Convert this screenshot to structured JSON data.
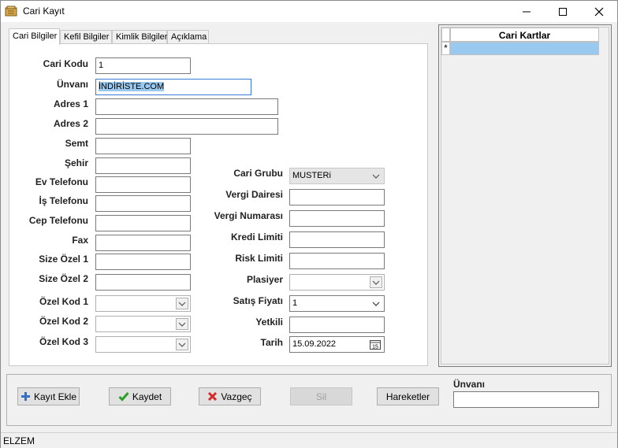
{
  "window": {
    "title": "Cari Kayıt",
    "minimize": "—",
    "maximize": "☐",
    "close": "✕"
  },
  "tabs": [
    "Cari Bilgiler",
    "Kefil Bilgiler",
    "Kimlik Bilgiler",
    "Açıklama"
  ],
  "left_fields": {
    "cari_kodu": {
      "label": "Cari Kodu",
      "value": "1"
    },
    "unvani": {
      "label": "Ünvanı",
      "value": "İNDİRİSTE.COM"
    },
    "adres1": {
      "label": "Adres 1",
      "value": ""
    },
    "adres2": {
      "label": "Adres 2",
      "value": ""
    },
    "semt": {
      "label": "Semt",
      "value": ""
    },
    "sehir": {
      "label": "Şehir",
      "value": ""
    },
    "ev_telefonu": {
      "label": "Ev Telefonu",
      "value": ""
    },
    "is_telefonu": {
      "label": "İş Telefonu",
      "value": ""
    },
    "cep_telefonu": {
      "label": "Cep Telefonu",
      "value": ""
    },
    "fax": {
      "label": "Fax",
      "value": ""
    },
    "size_ozel1": {
      "label": "Size Özel 1",
      "value": ""
    },
    "size_ozel2": {
      "label": "Size Özel 2",
      "value": ""
    },
    "ozel_kod1": {
      "label": "Özel Kod 1",
      "value": ""
    },
    "ozel_kod2": {
      "label": "Özel Kod 2",
      "value": ""
    },
    "ozel_kod3": {
      "label": "Özel Kod 3",
      "value": ""
    }
  },
  "right_fields": {
    "cari_grubu": {
      "label": "Cari Grubu",
      "value": "MUSTERi"
    },
    "vergi_dairesi": {
      "label": "Vergi Dairesi",
      "value": ""
    },
    "vergi_numarasi": {
      "label": "Vergi Numarası",
      "value": ""
    },
    "kredi_limiti": {
      "label": "Kredi Limiti",
      "value": ""
    },
    "risk_limiti": {
      "label": "Risk Limiti",
      "value": ""
    },
    "plasiyer": {
      "label": "Plasiyer",
      "value": ""
    },
    "satis_fiyati": {
      "label": "Satış Fiyatı",
      "value": "1"
    },
    "yetkili": {
      "label": "Yetkili",
      "value": ""
    },
    "tarih": {
      "label": "Tarih",
      "value": "15.09.2022"
    }
  },
  "grid": {
    "header": "Cari Kartlar",
    "new_row_marker": "*"
  },
  "buttons": {
    "kayit_ekle": "Kayıt Ekle",
    "kaydet": "Kaydet",
    "vazgec": "Vazgeç",
    "sil": "Sil",
    "hareketler": "Hareketler"
  },
  "search": {
    "label": "Ünvanı",
    "value": ""
  },
  "status": {
    "text": "ELZEM"
  },
  "colors": {
    "selection": "#99c9ef",
    "focus_border": "#3a7bd5",
    "save_check": "#2a9d2a",
    "cancel_x": "#d42a2a",
    "add_plus": "#2f6fd0"
  }
}
